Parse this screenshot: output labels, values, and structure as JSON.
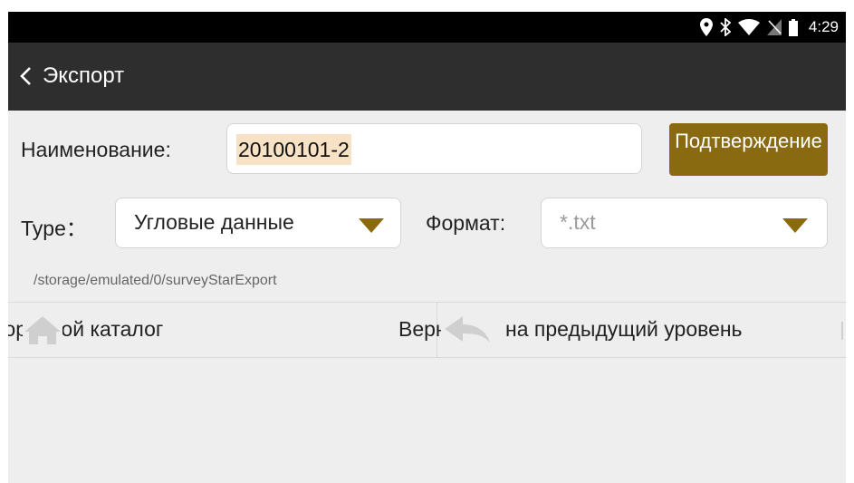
{
  "status_bar": {
    "icons": [
      "location-icon",
      "bluetooth-icon",
      "wifi-icon",
      "no-sim-icon",
      "battery-icon"
    ],
    "time": "4:29"
  },
  "title_bar": {
    "back_icon": "chevron-left-icon",
    "title": "Экспорт"
  },
  "form": {
    "name_label": "Наименование:",
    "name_value": "20100101-2",
    "confirm_label": "Подтверждение",
    "type_label": "Type：",
    "type_selected": "Угловые данные",
    "format_label": "Формат:",
    "format_placeholder": "*.txt",
    "path": "/storage/emulated/0/surveyStarExport"
  },
  "navigation": {
    "root_icon": "home-icon",
    "root_label": "Корневой каталог",
    "up_icon": "reply-arrow-icon",
    "up_label": "Вернуться на предыдущий уровень"
  },
  "colors": {
    "accent": "#8a6a10",
    "titlebar": "#2e2e2e",
    "background": "#eeeeee",
    "selection": "#f7e2c6"
  }
}
